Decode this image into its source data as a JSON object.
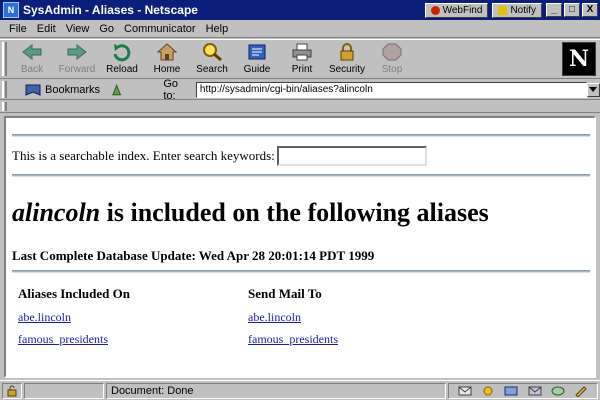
{
  "window": {
    "title": "SysAdmin - Aliases - Netscape",
    "webfind_label": "WebFind",
    "notify_label": "Notify",
    "btn_minimize": "_",
    "btn_maximize": "□",
    "btn_close": "X"
  },
  "menu": {
    "file": "File",
    "edit": "Edit",
    "view": "View",
    "go": "Go",
    "communicator": "Communicator",
    "help": "Help"
  },
  "toolbar": {
    "back": "Back",
    "forward": "Forward",
    "reload": "Reload",
    "home": "Home",
    "search": "Search",
    "guide": "Guide",
    "print": "Print",
    "security": "Security",
    "stop": "Stop",
    "logo_letter": "N"
  },
  "location": {
    "bookmarks_label": "Bookmarks",
    "goto_label": "Go to:",
    "url": "http://sysadmin/cgi-bin/aliases?alincoln"
  },
  "page": {
    "search_prompt": "This is a searchable index. Enter search keywords:",
    "search_value": "",
    "heading_user": "alincoln",
    "heading_rest": "is included on the following aliases",
    "last_update": "Last Complete Database Update: Wed Apr 28 20:01:14 PDT 1999",
    "col_aliases": "Aliases Included On",
    "col_sendmail": "Send Mail To",
    "aliases": [
      "abe.lincoln",
      "famous_presidents"
    ],
    "mail_to": [
      "abe.lincoln",
      "famous_presidents"
    ]
  },
  "status": {
    "text": "Document: Done"
  },
  "colors": {
    "titlebar": "#0a1e7a",
    "link": "#1c1ca8",
    "chrome": "#c0c0c0"
  }
}
